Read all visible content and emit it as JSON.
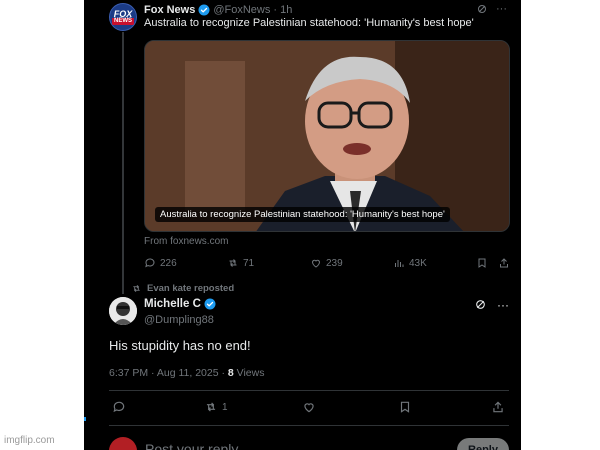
{
  "original_post": {
    "author_name": "Fox News",
    "author_handle": "@FoxNews",
    "time_ago": "· 1h",
    "text": "Australia to recognize Palestinian statehood: 'Humanity's best hope'",
    "avatar": {
      "line1": "FOX",
      "line2": "NEWS"
    },
    "card": {
      "caption": "Australia to recognize Palestinian statehood: 'Humanity's best hope'",
      "source": "From foxnews.com"
    },
    "stats": {
      "replies": "226",
      "reposts": "71",
      "likes": "239",
      "views": "43K"
    }
  },
  "repost_note": "Evan kate reposted",
  "quote_post": {
    "author_name": "Michelle C",
    "author_handle": "@Dumpling88",
    "text": "His stupidity has no end!",
    "timestamp": "6:37 PM · Aug 11, 2025 · ",
    "views_count": "8",
    "views_label": " Views",
    "stats": {
      "reposts": "1"
    }
  },
  "reply_box": {
    "placeholder": "Post your reply",
    "button_label": "Reply"
  },
  "watermark": "imgflip.com",
  "colors": {
    "background": "#000000",
    "text_primary": "#e7e9ea",
    "text_secondary": "#71767b",
    "verified": "#1d9bf0",
    "divider": "#2f3336"
  },
  "icons": [
    "verified-badge-icon",
    "grok-icon",
    "more-icon",
    "reply-icon",
    "repost-icon",
    "like-icon",
    "views-icon",
    "bookmark-icon",
    "share-icon"
  ]
}
